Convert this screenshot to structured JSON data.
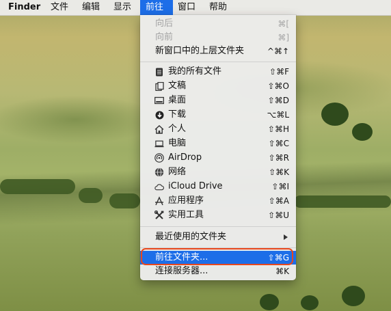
{
  "menubar": {
    "items": [
      {
        "label": "Finder"
      },
      {
        "label": "文件"
      },
      {
        "label": "编辑"
      },
      {
        "label": "显示"
      },
      {
        "label": "前往"
      },
      {
        "label": "窗口"
      },
      {
        "label": "帮助"
      }
    ]
  },
  "go_menu": {
    "items": [
      {
        "label": "向后",
        "shortcut": "⌘[",
        "enabled": false
      },
      {
        "label": "向前",
        "shortcut": "⌘]",
        "enabled": false
      },
      {
        "label": "新窗口中的上层文件夹",
        "shortcut": "^⌘↑",
        "enabled": true
      },
      {
        "label": "我的所有文件",
        "shortcut": "⇧⌘F",
        "icon": "all-files-icon"
      },
      {
        "label": "文稿",
        "shortcut": "⇧⌘O",
        "icon": "documents-icon"
      },
      {
        "label": "桌面",
        "shortcut": "⇧⌘D",
        "icon": "desktop-icon"
      },
      {
        "label": "下载",
        "shortcut": "⌥⌘L",
        "icon": "downloads-icon"
      },
      {
        "label": "个人",
        "shortcut": "⇧⌘H",
        "icon": "home-icon"
      },
      {
        "label": "电脑",
        "shortcut": "⇧⌘C",
        "icon": "computer-icon"
      },
      {
        "label": "AirDrop",
        "shortcut": "⇧⌘R",
        "icon": "airdrop-icon"
      },
      {
        "label": "网络",
        "shortcut": "⇧⌘K",
        "icon": "network-icon"
      },
      {
        "label": "iCloud Drive",
        "shortcut": "⇧⌘I",
        "icon": "cloud-icon"
      },
      {
        "label": "应用程序",
        "shortcut": "⇧⌘A",
        "icon": "applications-icon"
      },
      {
        "label": "实用工具",
        "shortcut": "⇧⌘U",
        "icon": "utilities-icon"
      },
      {
        "label": "最近使用的文件夹",
        "has_submenu": true
      },
      {
        "label": "前往文件夹...",
        "shortcut": "⇧⌘G",
        "highlighted": true
      },
      {
        "label": "连接服务器...",
        "shortcut": "⌘K"
      }
    ]
  },
  "colors": {
    "highlight": "#1d6ee8",
    "annotation_ring": "#e8471d"
  }
}
